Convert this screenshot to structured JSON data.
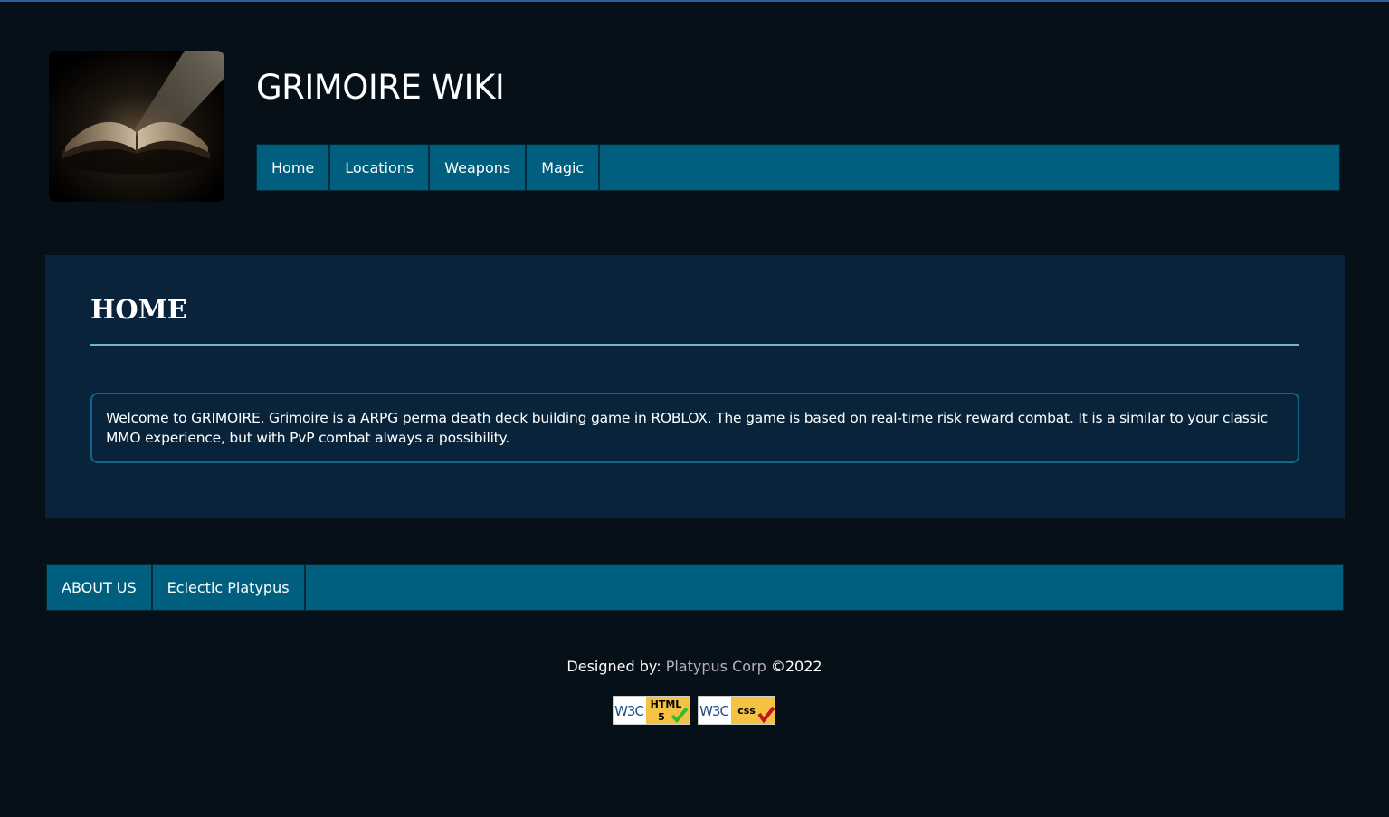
{
  "site": {
    "title": "GRIMOIRE WIKI",
    "logo_icon": "open-book-logo"
  },
  "nav": {
    "items": [
      {
        "label": "Home"
      },
      {
        "label": "Locations"
      },
      {
        "label": "Weapons"
      },
      {
        "label": "Magic"
      }
    ]
  },
  "main": {
    "heading": "HOME",
    "welcome_text": "Welcome to GRIMOIRE. Grimoire is a ARPG perma death deck building game in ROBLOX. The game is based on real-time risk reward combat. It is a similar to your classic MMO experience, but with PvP combat always a possibility."
  },
  "footer_nav": {
    "items": [
      {
        "label": "ABOUT US"
      },
      {
        "label": "Eclectic Platypus"
      }
    ]
  },
  "credits": {
    "prefix": "Designed by:",
    "company": "Platypus Corp",
    "copyright": "©2022"
  },
  "badges": {
    "html": {
      "org": "W3C",
      "label": "HTML",
      "version": "5"
    },
    "css": {
      "org": "W3C",
      "label": "css"
    }
  },
  "colors": {
    "background": "#061018",
    "panel": "#08233a",
    "nav": "#005f7f",
    "accent_rule": "#6cb7cf",
    "link": "#b7b0c8"
  }
}
